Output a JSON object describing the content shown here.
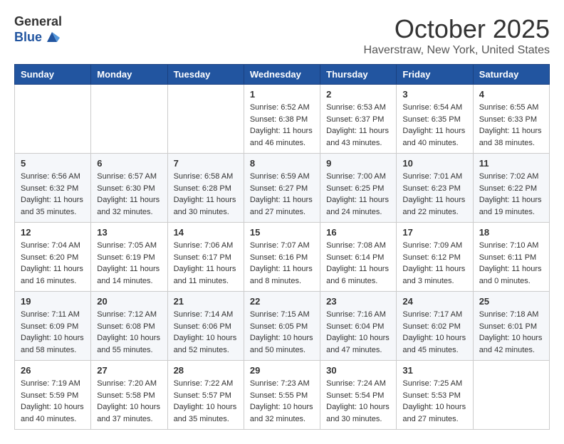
{
  "header": {
    "logo_general": "General",
    "logo_blue": "Blue",
    "month_title": "October 2025",
    "location": "Haverstraw, New York, United States"
  },
  "weekdays": [
    "Sunday",
    "Monday",
    "Tuesday",
    "Wednesday",
    "Thursday",
    "Friday",
    "Saturday"
  ],
  "weeks": [
    [
      {
        "day": "",
        "info": ""
      },
      {
        "day": "",
        "info": ""
      },
      {
        "day": "",
        "info": ""
      },
      {
        "day": "1",
        "info": "Sunrise: 6:52 AM\nSunset: 6:38 PM\nDaylight: 11 hours and 46 minutes."
      },
      {
        "day": "2",
        "info": "Sunrise: 6:53 AM\nSunset: 6:37 PM\nDaylight: 11 hours and 43 minutes."
      },
      {
        "day": "3",
        "info": "Sunrise: 6:54 AM\nSunset: 6:35 PM\nDaylight: 11 hours and 40 minutes."
      },
      {
        "day": "4",
        "info": "Sunrise: 6:55 AM\nSunset: 6:33 PM\nDaylight: 11 hours and 38 minutes."
      }
    ],
    [
      {
        "day": "5",
        "info": "Sunrise: 6:56 AM\nSunset: 6:32 PM\nDaylight: 11 hours and 35 minutes."
      },
      {
        "day": "6",
        "info": "Sunrise: 6:57 AM\nSunset: 6:30 PM\nDaylight: 11 hours and 32 minutes."
      },
      {
        "day": "7",
        "info": "Sunrise: 6:58 AM\nSunset: 6:28 PM\nDaylight: 11 hours and 30 minutes."
      },
      {
        "day": "8",
        "info": "Sunrise: 6:59 AM\nSunset: 6:27 PM\nDaylight: 11 hours and 27 minutes."
      },
      {
        "day": "9",
        "info": "Sunrise: 7:00 AM\nSunset: 6:25 PM\nDaylight: 11 hours and 24 minutes."
      },
      {
        "day": "10",
        "info": "Sunrise: 7:01 AM\nSunset: 6:23 PM\nDaylight: 11 hours and 22 minutes."
      },
      {
        "day": "11",
        "info": "Sunrise: 7:02 AM\nSunset: 6:22 PM\nDaylight: 11 hours and 19 minutes."
      }
    ],
    [
      {
        "day": "12",
        "info": "Sunrise: 7:04 AM\nSunset: 6:20 PM\nDaylight: 11 hours and 16 minutes."
      },
      {
        "day": "13",
        "info": "Sunrise: 7:05 AM\nSunset: 6:19 PM\nDaylight: 11 hours and 14 minutes."
      },
      {
        "day": "14",
        "info": "Sunrise: 7:06 AM\nSunset: 6:17 PM\nDaylight: 11 hours and 11 minutes."
      },
      {
        "day": "15",
        "info": "Sunrise: 7:07 AM\nSunset: 6:16 PM\nDaylight: 11 hours and 8 minutes."
      },
      {
        "day": "16",
        "info": "Sunrise: 7:08 AM\nSunset: 6:14 PM\nDaylight: 11 hours and 6 minutes."
      },
      {
        "day": "17",
        "info": "Sunrise: 7:09 AM\nSunset: 6:12 PM\nDaylight: 11 hours and 3 minutes."
      },
      {
        "day": "18",
        "info": "Sunrise: 7:10 AM\nSunset: 6:11 PM\nDaylight: 11 hours and 0 minutes."
      }
    ],
    [
      {
        "day": "19",
        "info": "Sunrise: 7:11 AM\nSunset: 6:09 PM\nDaylight: 10 hours and 58 minutes."
      },
      {
        "day": "20",
        "info": "Sunrise: 7:12 AM\nSunset: 6:08 PM\nDaylight: 10 hours and 55 minutes."
      },
      {
        "day": "21",
        "info": "Sunrise: 7:14 AM\nSunset: 6:06 PM\nDaylight: 10 hours and 52 minutes."
      },
      {
        "day": "22",
        "info": "Sunrise: 7:15 AM\nSunset: 6:05 PM\nDaylight: 10 hours and 50 minutes."
      },
      {
        "day": "23",
        "info": "Sunrise: 7:16 AM\nSunset: 6:04 PM\nDaylight: 10 hours and 47 minutes."
      },
      {
        "day": "24",
        "info": "Sunrise: 7:17 AM\nSunset: 6:02 PM\nDaylight: 10 hours and 45 minutes."
      },
      {
        "day": "25",
        "info": "Sunrise: 7:18 AM\nSunset: 6:01 PM\nDaylight: 10 hours and 42 minutes."
      }
    ],
    [
      {
        "day": "26",
        "info": "Sunrise: 7:19 AM\nSunset: 5:59 PM\nDaylight: 10 hours and 40 minutes."
      },
      {
        "day": "27",
        "info": "Sunrise: 7:20 AM\nSunset: 5:58 PM\nDaylight: 10 hours and 37 minutes."
      },
      {
        "day": "28",
        "info": "Sunrise: 7:22 AM\nSunset: 5:57 PM\nDaylight: 10 hours and 35 minutes."
      },
      {
        "day": "29",
        "info": "Sunrise: 7:23 AM\nSunset: 5:55 PM\nDaylight: 10 hours and 32 minutes."
      },
      {
        "day": "30",
        "info": "Sunrise: 7:24 AM\nSunset: 5:54 PM\nDaylight: 10 hours and 30 minutes."
      },
      {
        "day": "31",
        "info": "Sunrise: 7:25 AM\nSunset: 5:53 PM\nDaylight: 10 hours and 27 minutes."
      },
      {
        "day": "",
        "info": ""
      }
    ]
  ]
}
